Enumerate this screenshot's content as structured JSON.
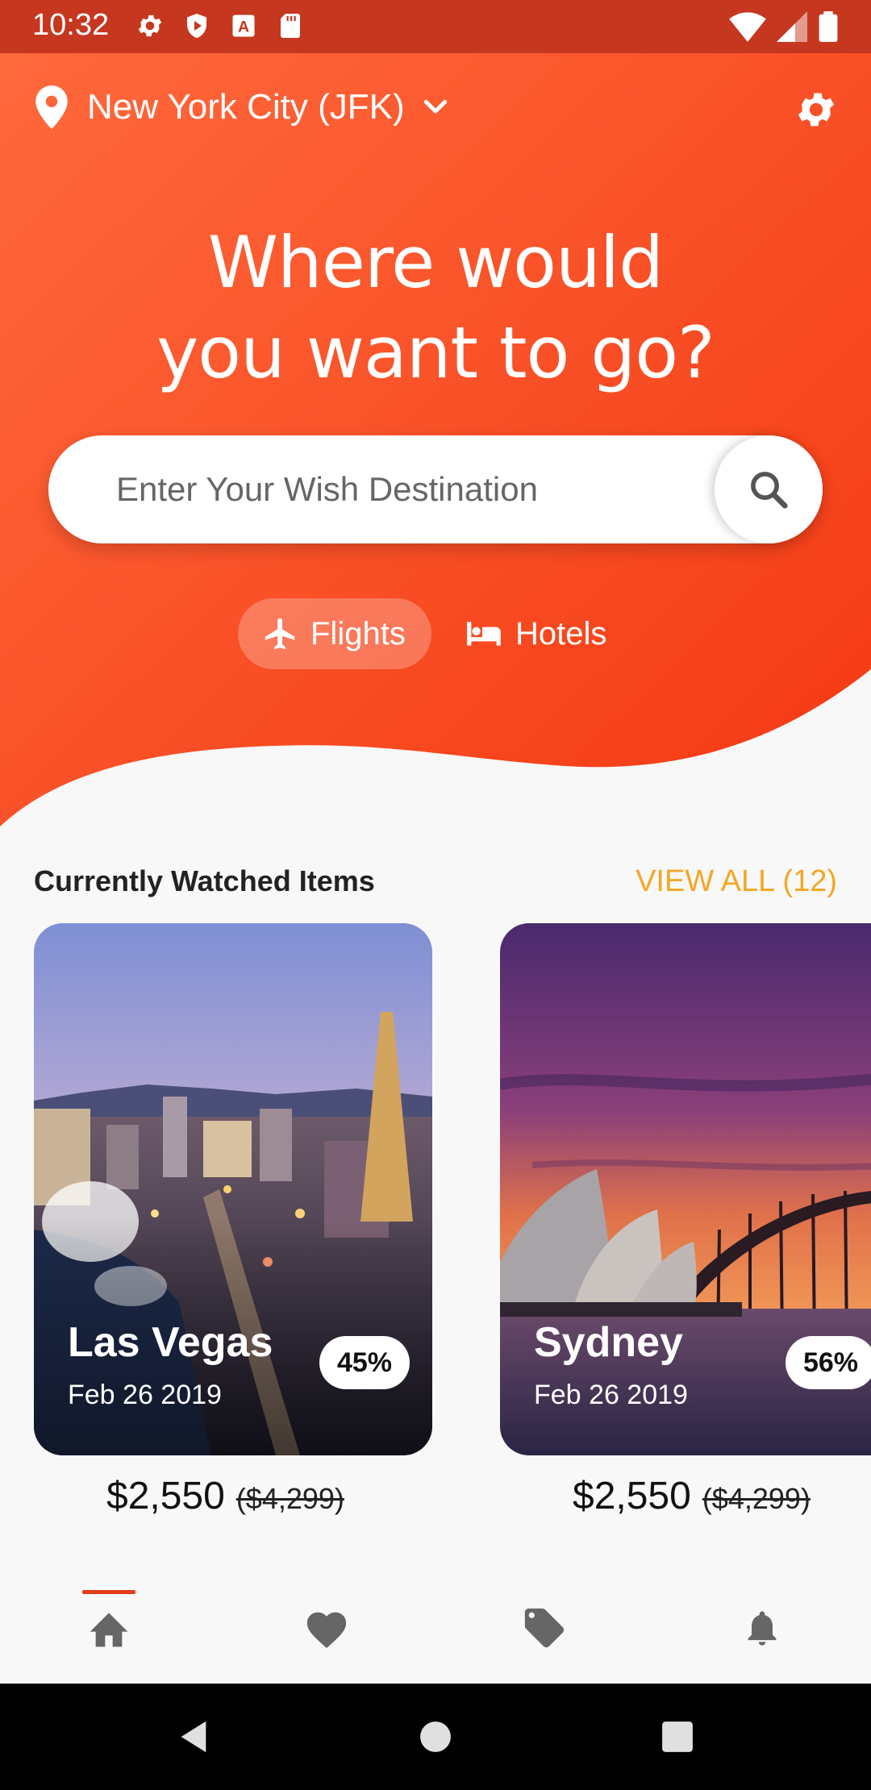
{
  "status_bar": {
    "time": "10:32"
  },
  "header": {
    "location": "New York City (JFK)",
    "headline_line1": "Where would",
    "headline_line2": "you want to go?"
  },
  "search": {
    "placeholder": "Enter Your Wish Destination"
  },
  "tabs": [
    {
      "label": "Flights",
      "icon": "airplane-icon",
      "active": true
    },
    {
      "label": "Hotels",
      "icon": "bed-icon",
      "active": false
    }
  ],
  "watched": {
    "title": "Currently Watched Items",
    "view_all": "VIEW ALL (12)",
    "items": [
      {
        "city": "Las Vegas",
        "date": "Feb 26 2019",
        "discount": "45%",
        "price": "$2,550",
        "old_price": "($4,299)"
      },
      {
        "city": "Sydney",
        "date": "Feb 26 2019",
        "discount": "56%",
        "price": "$2,550",
        "old_price": "($4,299)"
      }
    ]
  },
  "bottom_nav": [
    {
      "icon": "home-icon",
      "active": true
    },
    {
      "icon": "heart-icon",
      "active": false
    },
    {
      "icon": "tag-icon",
      "active": false
    },
    {
      "icon": "bell-icon",
      "active": false
    }
  ],
  "colors": {
    "accent": "#f5a623",
    "hero_start": "#ff6a3d",
    "hero_end": "#f23c14"
  }
}
